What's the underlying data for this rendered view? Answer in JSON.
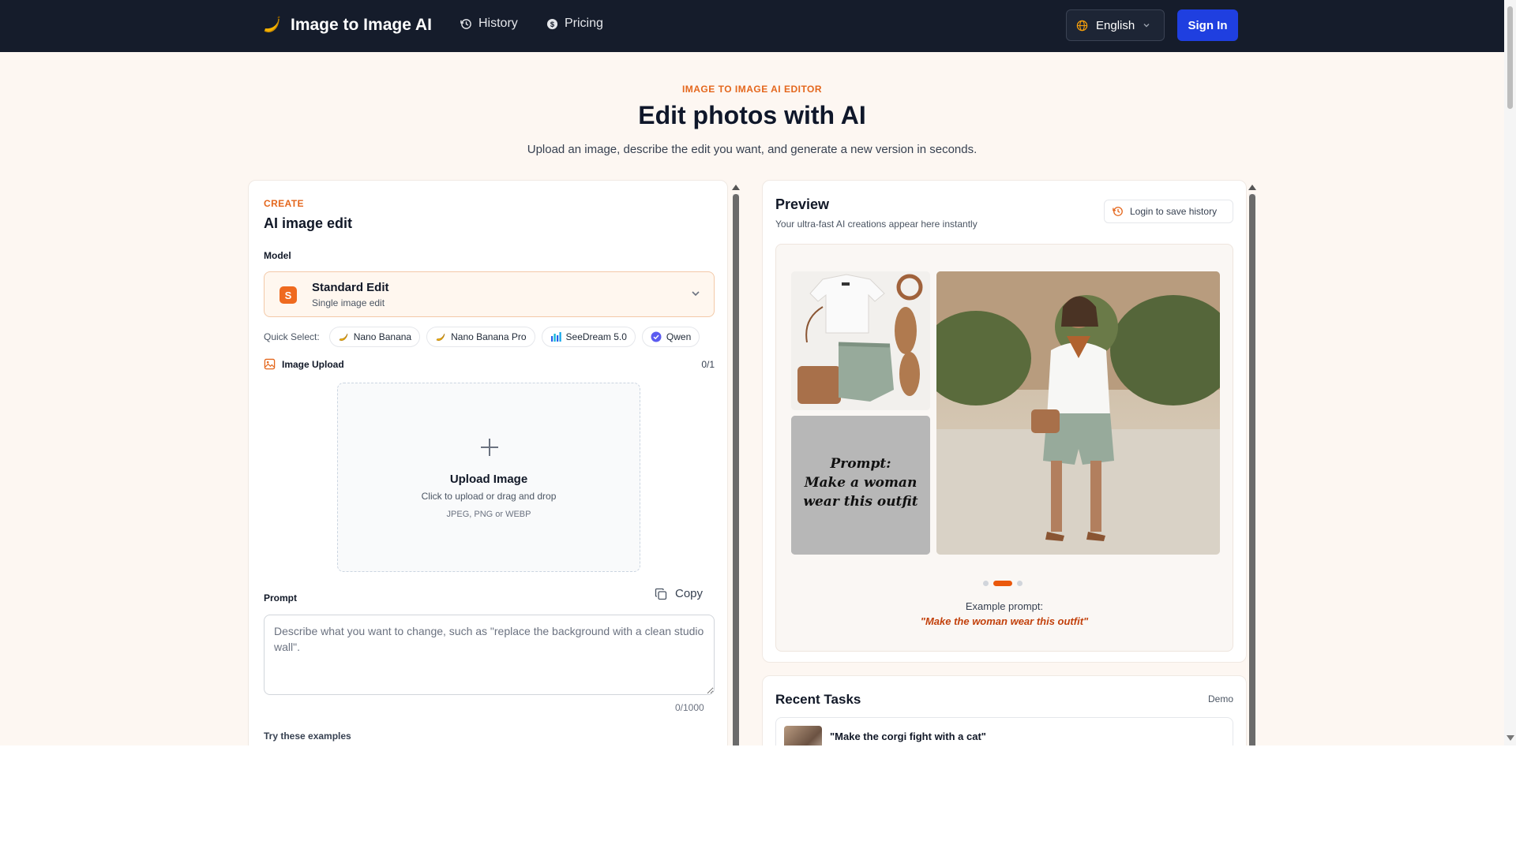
{
  "header": {
    "brand": "Image to Image AI",
    "nav": [
      {
        "label": "History",
        "icon": "history-icon"
      },
      {
        "label": "Pricing",
        "icon": "pricing-icon"
      }
    ],
    "language": "English",
    "sign_in": "Sign In"
  },
  "hero": {
    "eyebrow": "IMAGE TO IMAGE AI EDITOR",
    "title": "Edit photos with AI",
    "subtitle": "Upload an image, describe the edit you want, and generate a new version in seconds."
  },
  "create": {
    "eyebrow": "CREATE",
    "title": "AI image edit",
    "model_label": "Model",
    "model": {
      "badge": "S",
      "name": "Standard Edit",
      "sub": "Single image edit"
    },
    "quick_select_label": "Quick Select:",
    "quick_select": [
      {
        "label": "Nano Banana",
        "icon": "banana-icon"
      },
      {
        "label": "Nano Banana Pro",
        "icon": "banana-icon"
      },
      {
        "label": "SeeDream 5.0",
        "icon": "bar-chart-icon"
      },
      {
        "label": "Qwen",
        "icon": "check-circle-icon"
      }
    ],
    "upload": {
      "label": "Image Upload",
      "count": "0/1",
      "title": "Upload Image",
      "hint": "Click to upload or drag and drop",
      "types": "JPEG, PNG or WEBP"
    },
    "prompt": {
      "label": "Prompt",
      "copy": "Copy",
      "placeholder": "Describe what you want to change, such as \"replace the background with a clean studio wall\".",
      "value": "",
      "count": "0/1000"
    },
    "examples_label": "Try these examples"
  },
  "preview": {
    "title": "Preview",
    "subtitle": "Your ultra-fast AI creations appear here instantly",
    "history_button": "Login to save history",
    "prompt_card_text": "Prompt: Make a woman wear this outfit",
    "carousel": {
      "count": 3,
      "active": 1
    },
    "example_label": "Example prompt:",
    "example_prompt": "\"Make the woman wear this outfit\""
  },
  "tasks": {
    "title": "Recent Tasks",
    "badge": "Demo",
    "items": [
      {
        "text": "\"Make the corgi fight with a cat\""
      }
    ]
  },
  "colors": {
    "nav_bg": "#151c2b",
    "accent": "#ea580c",
    "primary_button": "#1f3fe0",
    "page_bg": "#fdf7f2"
  }
}
